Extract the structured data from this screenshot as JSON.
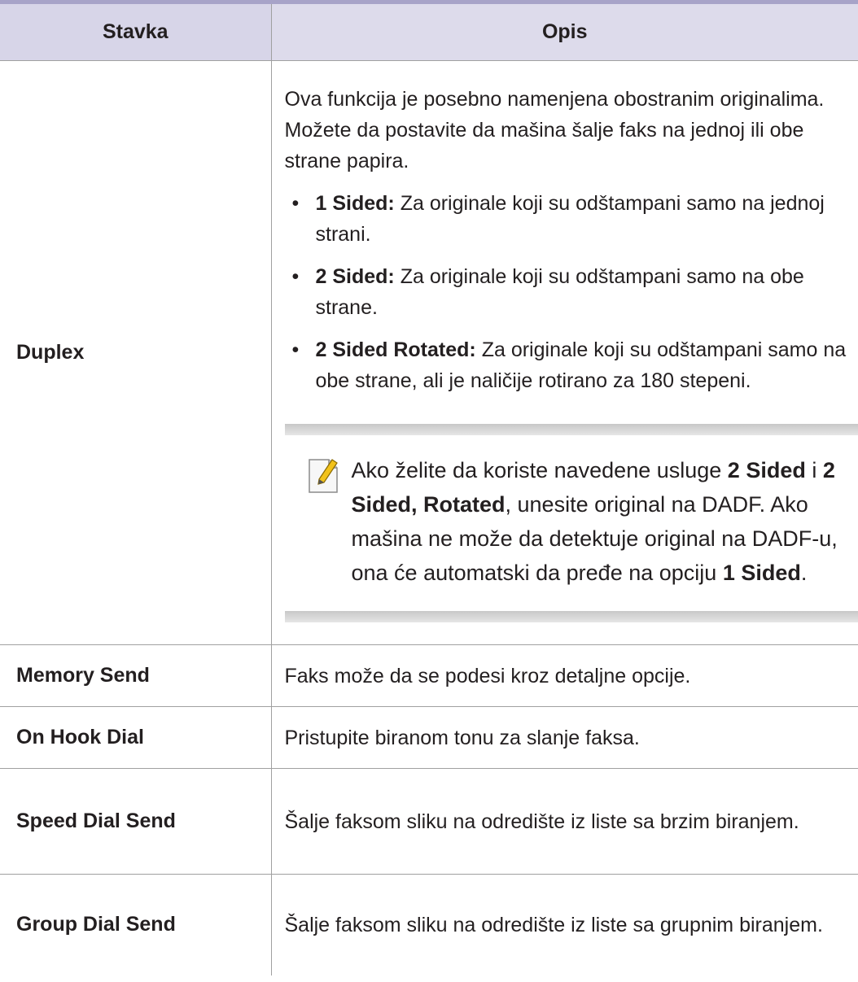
{
  "table": {
    "header": {
      "item": "Stavka",
      "description": "Opis"
    },
    "duplex": {
      "item": "Duplex",
      "intro": "Ova funkcija je posebno namenjena obostranim originalima. Možete da postavite da mašina šalje faks na jednoj ili obe strane papira.",
      "options": [
        {
          "label": "1 Sided:",
          "text": "Za originale koji su odštampani samo na jednoj strani."
        },
        {
          "label": "2 Sided:",
          "text": "Za originale koji su odštampani samo na obe strane."
        },
        {
          "label": "2 Sided Rotated:",
          "text": "Za originale koji su odštampani samo na obe strane, ali je naličije rotirano za 180 stepeni."
        }
      ],
      "note": {
        "icon": "note-pencil-icon",
        "t1": "Ako želite da koriste navedene usluge ",
        "b1": "2 Sided",
        "t2": " i ",
        "b2": "2 Sided, Rotated",
        "t3": ", unesite original na DADF. Ako mašina ne može da detektuje original na DADF-u, ona će automatski da pređe na opciju ",
        "b3": "1 Sided",
        "t4": "."
      }
    },
    "rows": [
      {
        "item": "Memory Send",
        "description": "Faks može da se podesi kroz detaljne opcije."
      },
      {
        "item": "On Hook Dial",
        "description": "Pristupite biranom tonu za slanje faksa."
      },
      {
        "item": "Speed Dial Send",
        "description": "Šalje faksom sliku na odredište iz liste sa brzim biranjem."
      },
      {
        "item": "Group Dial Send",
        "description": "Šalje faksom sliku na odredište iz liste sa grupnim biranjem."
      }
    ]
  }
}
